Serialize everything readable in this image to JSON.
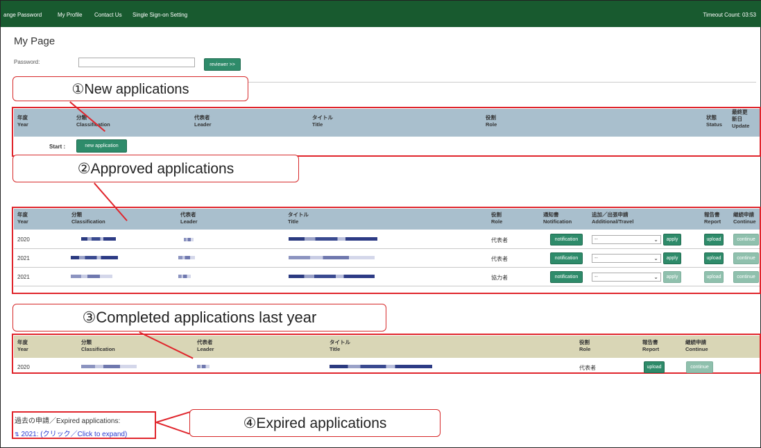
{
  "nav": {
    "items": [
      "ange Password",
      "My Profile",
      "Contact Us",
      "Single Sign-on Setting"
    ],
    "timeout": "Timeout Count: 03:53"
  },
  "page": {
    "title": "My Page",
    "password_label": "Password:",
    "reviewer_button": "reviewer >>"
  },
  "callouts": {
    "new": "①New applications",
    "approved": "②Approved applications",
    "completed": "③Completed applications last year",
    "expired": "④Expired applications"
  },
  "new_apps": {
    "headers": {
      "year_jp": "年度",
      "year_en": "Year",
      "class_jp": "分類",
      "class_en": "Classification",
      "leader_jp": "代表者",
      "leader_en": "Leader",
      "title_jp": "タイトル",
      "title_en": "Title",
      "role_jp": "役割",
      "role_en": "Role",
      "status_jp": "状態",
      "status_en": "Status",
      "update_jp1": "最終更",
      "update_jp2": "新日",
      "update_en": "Update"
    },
    "start_label": "Start :",
    "new_button": "new application"
  },
  "approved": {
    "headers": {
      "year_jp": "年度",
      "year_en": "Year",
      "class_jp": "分類",
      "class_en": "Classification",
      "leader_jp": "代表者",
      "leader_en": "Leader",
      "title_jp": "タイトル",
      "title_en": "Title",
      "role_jp": "役割",
      "role_en": "Role",
      "notif_jp": "通知書",
      "notif_en": "Notification",
      "add_jp": "追加／出張申請",
      "add_en": "Additional/Travel",
      "report_jp": "報告書",
      "report_en": "Report",
      "cont_jp": "継続申請",
      "cont_en": "Continue"
    },
    "rows": [
      {
        "year": "2020",
        "role": "代表者"
      },
      {
        "year": "2021",
        "role": "代表者"
      },
      {
        "year": "2021",
        "role": "協力者"
      }
    ],
    "select_value": "--",
    "notification_button": "notification",
    "apply_button": "apply",
    "upload_button": "upload",
    "continue_button": "continue"
  },
  "completed": {
    "headers": {
      "year_jp": "年度",
      "year_en": "Year",
      "class_jp": "分類",
      "class_en": "Classification",
      "leader_jp": "代表者",
      "leader_en": "Leader",
      "title_jp": "タイトル",
      "title_en": "Title",
      "role_jp": "役割",
      "role_en": "Role",
      "report_jp": "報告書",
      "report_en": "Report",
      "cont_jp": "継続申請",
      "cont_en": "Continue"
    },
    "rows": [
      {
        "year": "2020",
        "role": "代表者"
      }
    ],
    "upload_button": "upload",
    "continue_button": "continue"
  },
  "expired": {
    "heading": "過去の申請／Expired applications:",
    "link": "2021: (クリック／Click to expand)",
    "link_icon": "⇅"
  }
}
